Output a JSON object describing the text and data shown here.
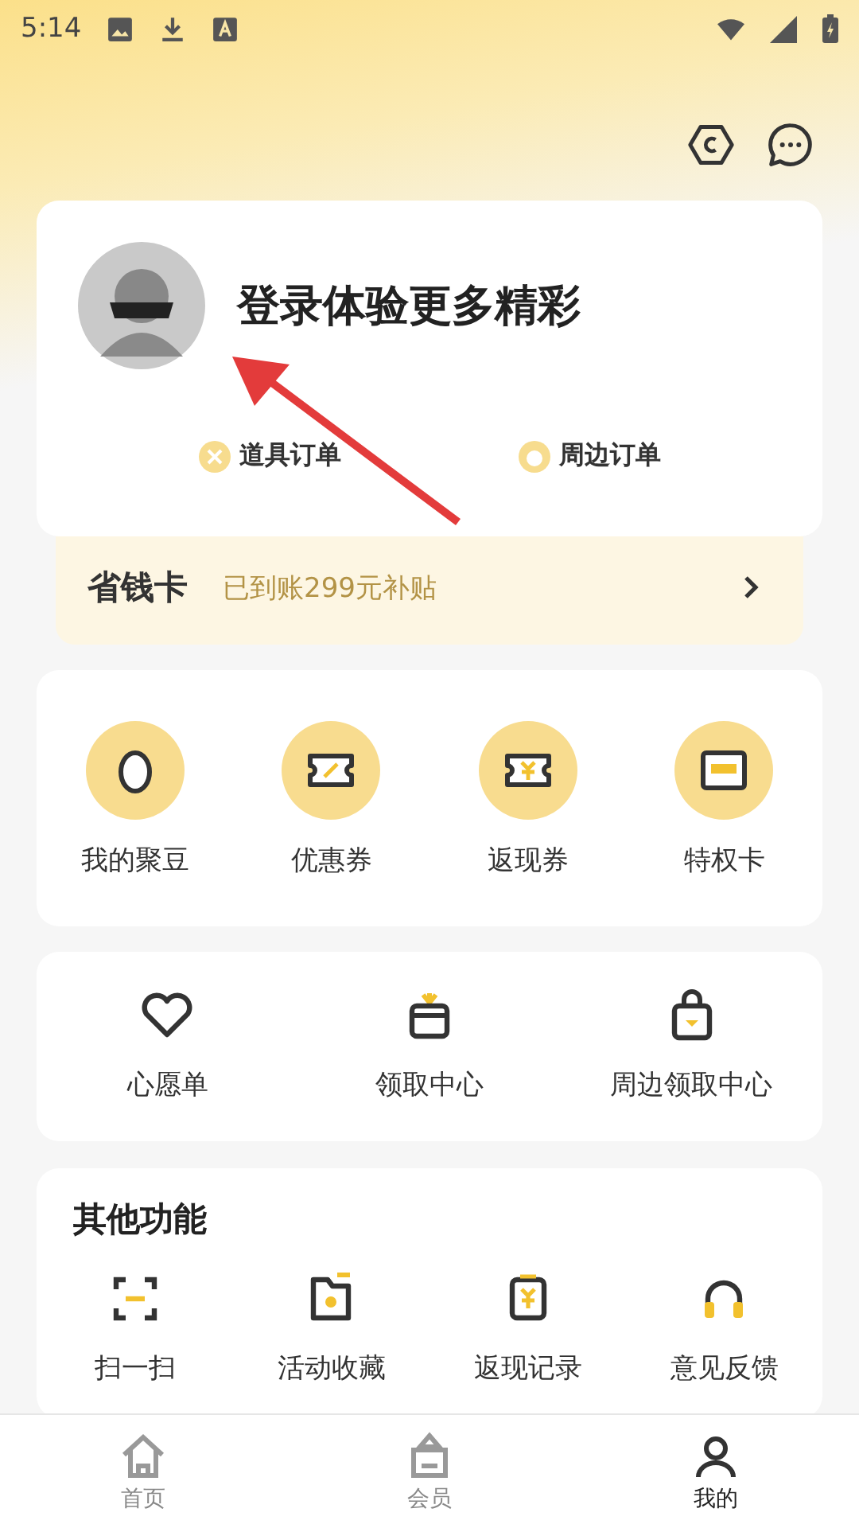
{
  "status_bar": {
    "time": "5:14"
  },
  "profile": {
    "title": "登录体验更多精彩",
    "orders": [
      "道具订单",
      "周边订单"
    ]
  },
  "savings_card": {
    "title": "省钱卡",
    "subtitle": "已到账299元补贴"
  },
  "assets": [
    {
      "label": "我的聚豆"
    },
    {
      "label": "优惠券"
    },
    {
      "label": "返现券"
    },
    {
      "label": "特权卡"
    }
  ],
  "quick_links": [
    {
      "label": "心愿单"
    },
    {
      "label": "领取中心"
    },
    {
      "label": "周边领取中心"
    }
  ],
  "other_functions": {
    "title": "其他功能",
    "items": [
      {
        "label": "扫一扫"
      },
      {
        "label": "活动收藏"
      },
      {
        "label": "返现记录"
      },
      {
        "label": "意见反馈"
      }
    ]
  },
  "bottom_nav": [
    {
      "label": "首页",
      "selected": false
    },
    {
      "label": "会员",
      "selected": false
    },
    {
      "label": "我的",
      "selected": true
    }
  ]
}
